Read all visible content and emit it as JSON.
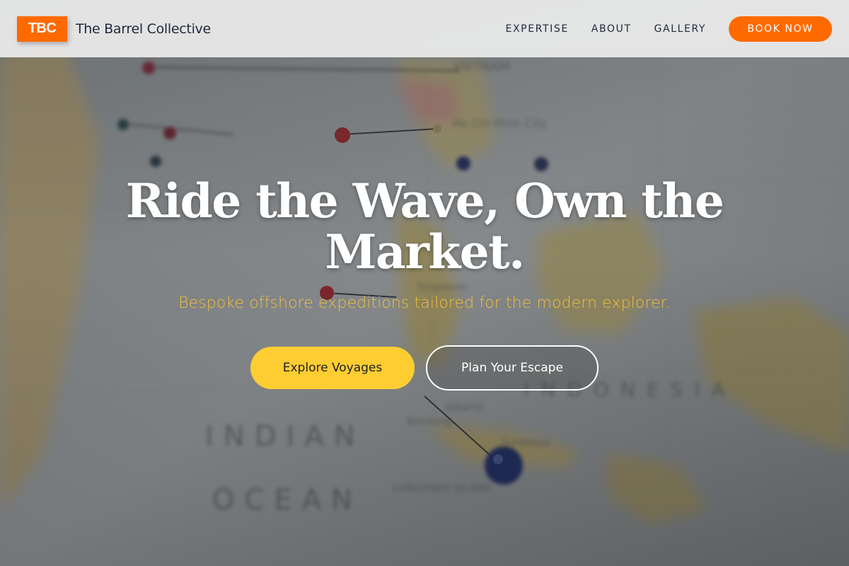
{
  "nav": {
    "logo_text": "TBC",
    "brand": "The Barrel Collective",
    "links": [
      "EXPERTISE",
      "ABOUT",
      "GALLERY"
    ],
    "cta": "BOOK NOW"
  },
  "hero": {
    "headline_line1": "Ride the Wave, Own the",
    "headline_line2": "Market.",
    "subtitle": "Bespoke offshore expeditions tailored for the modern explorer.",
    "primary_button": "Explore Voyages",
    "secondary_button": "Plan Your Escape",
    "background": "map-with-pins-photo"
  },
  "colors": {
    "accent_orange": "#ff6a00",
    "accent_yellow": "#fecd32",
    "subtitle_gold": "#f0bf3c",
    "nav_text": "#1f2a3a"
  }
}
